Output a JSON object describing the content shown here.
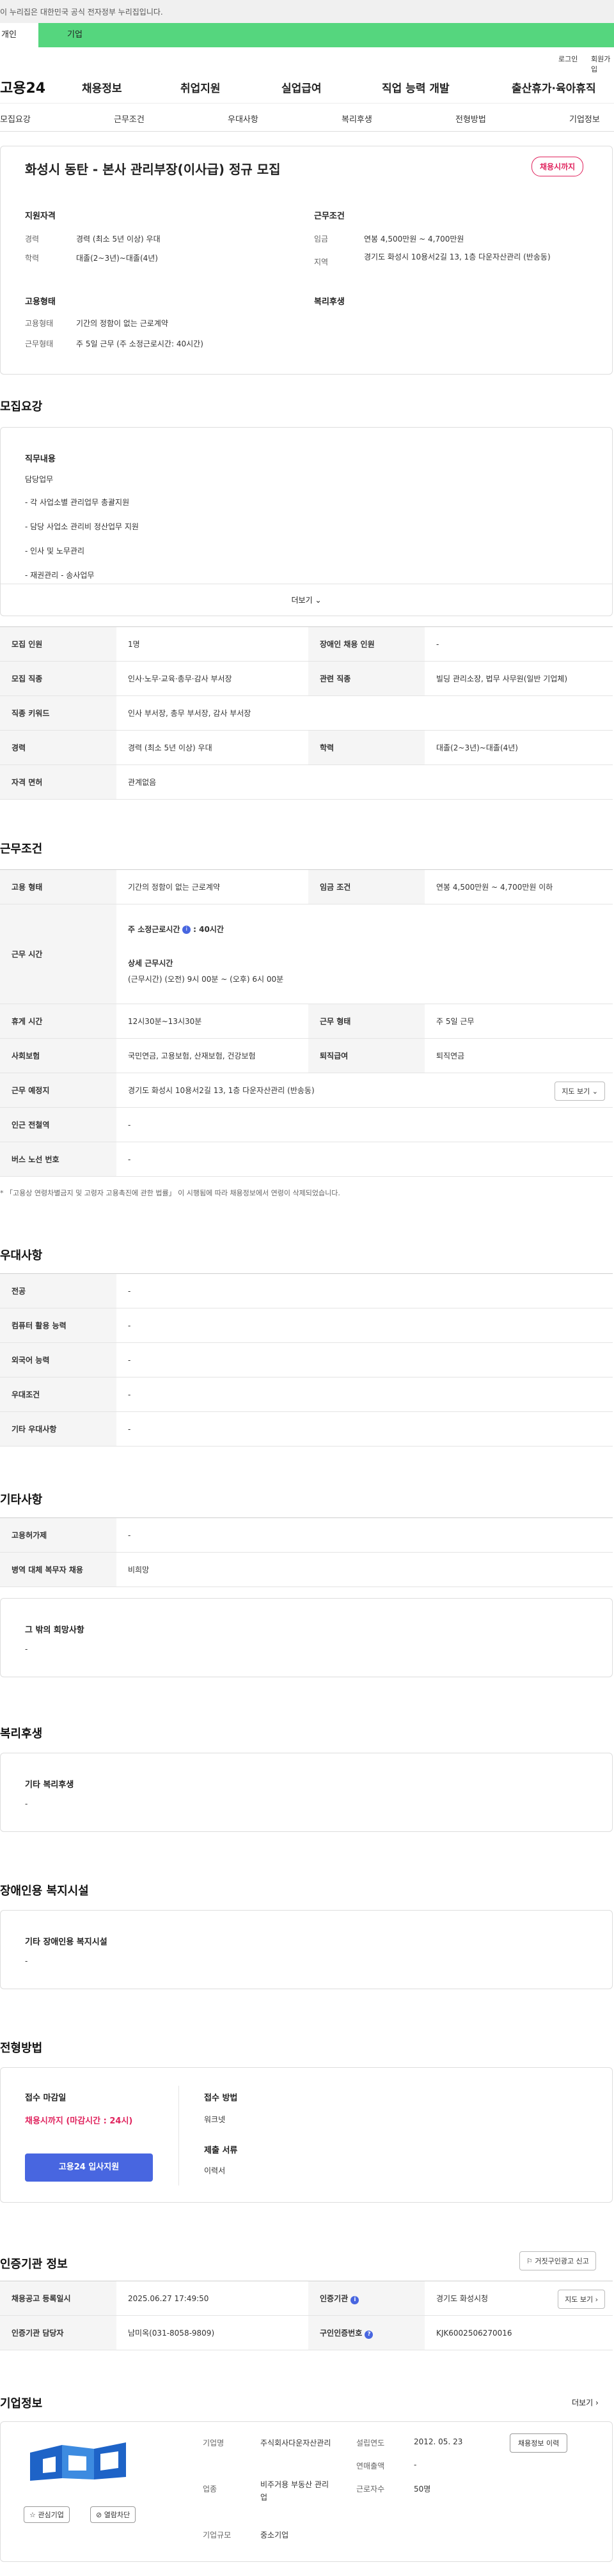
{
  "topbar": {
    "gov_notice": "이 누리집은 대한민국 공식 전자정부 누리집입니다."
  },
  "userbar": {
    "left": "개인",
    "right": "기업"
  },
  "util": {
    "login": "로그인",
    "join": "회원가입"
  },
  "gnb": {
    "logo": "고용24",
    "menus": [
      "채용정보",
      "취업지원",
      "실업급여",
      "직업 능력 개발",
      "출산휴가·육아휴직"
    ]
  },
  "tabs": [
    "모집요강",
    "근무조건",
    "우대사항",
    "복리후생",
    "전형방법",
    "기업정보"
  ],
  "summary": {
    "title": "화성시 동탄 - 본사 관리부장(이사급) 정규 모집",
    "badge": "채용시까지",
    "qual_heading": "지원자격",
    "career_label": "경력",
    "career_value": "경력 (최소 5년 이상) 우대",
    "edu_label": "학력",
    "edu_value": "대졸(2~3년)~대졸(4년)",
    "cond_heading": "근무조건",
    "wage_label": "임금",
    "wage_value": "연봉 4,500만원 ~ 4,700만원",
    "region_label": "지역",
    "region_value": "경기도 화성시 10용서2길 13, 1층 다운자산관리 (반송동)",
    "emp_heading": "고용형태",
    "emp_type_label": "고용형태",
    "emp_type_value": "기간의 정함이 없는 근로계약",
    "work_type_label": "근무형태",
    "work_type_value": "주 5일 근무 (주 소정근로시간: 40시간)",
    "welfare_heading": "복리후생"
  },
  "recruit": {
    "title": "모집요강",
    "job_heading": "직무내용",
    "lines": [
      "담당업무",
      "- 각 사업소별 관리업무 총괄지원",
      "- 담당 사업소 관리비 정산업무 지원",
      "- 인사 및 노무관리",
      "- 재권관리 - 송사업무"
    ],
    "more": "더보기",
    "rows": [
      [
        "모집 인원",
        "1명",
        "장애인 채용 인원",
        "-"
      ],
      [
        "모집 직종",
        "인사·노무·교육·총무·감사 부서장",
        "관련 직종",
        "빌딩 관리소장, 법무 사무원(일반 기업체)"
      ],
      [
        "직종 키워드",
        "인사 부서장, 총무 부서장, 감사 부서장",
        "",
        ""
      ],
      [
        "경력",
        "경력 (최소 5년 이상) 우대",
        "학력",
        "대졸(2~3년)~대졸(4년)"
      ],
      [
        "자격 면허",
        "관계없음",
        "",
        ""
      ]
    ]
  },
  "work": {
    "title": "근무조건",
    "emp_label": "고용 형태",
    "emp_value": "기간의 정함이 없는 근로계약",
    "wage_label": "임금 조건",
    "wage_value": "연봉 4,500만원 ~ 4,700만원 이하",
    "hours_label": "근무 시간",
    "hours_weekly": "주 소정근로시간",
    "hours_weekly_value": ": 40시간",
    "hours_detail_heading": "상세 근무시간",
    "hours_detail_value": "(근무시간) (오전) 9시 00분 ~ (오후) 6시 00분",
    "break_label": "휴게 시간",
    "break_value": "12시30분~13시30분",
    "form_label": "근무 형태",
    "form_value": "주 5일 근무",
    "insurance_label": "사회보험",
    "insurance_value": "국민연금, 고용보험, 산재보험, 건강보험",
    "retire_label": "퇴직급여",
    "retire_value": "퇴직연금",
    "place_label": "근무 예정지",
    "place_value": "경기도 화성시 10용서2길 13, 1층 다운자산관리 (반송동)",
    "map_btn": "지도 보기",
    "subway_label": "인근 전철역",
    "subway_value": "-",
    "bus_label": "버스 노선 번호",
    "bus_value": "-",
    "note": "* 「고용상 연령차별금지 및 고령자 고용촉진에 관한 법률」 이 시행됨에 따라 채용정보에서 연령이 삭제되었습니다."
  },
  "prefer": {
    "title": "우대사항",
    "rows": [
      [
        "전공",
        "-"
      ],
      [
        "컴퓨터 활용 능력",
        "-"
      ],
      [
        "외국어 능력",
        "-"
      ],
      [
        "우대조건",
        "-"
      ],
      [
        "기타 우대사항",
        "-"
      ]
    ]
  },
  "etc": {
    "title": "기타사항",
    "rows": [
      [
        "고용허가제",
        "-"
      ],
      [
        "병역 대체 복무자 채용",
        "비희망"
      ]
    ],
    "other_heading": "그 밖의 희망사항",
    "other_value": "-"
  },
  "welfare": {
    "title": "복리후생",
    "heading": "기타 복리후생",
    "value": "-"
  },
  "disabled": {
    "title": "장애인용 복지시설",
    "heading": "기타 장애인용 복지시설",
    "value": "-"
  },
  "process": {
    "title": "전형방법",
    "deadline_heading": "접수 마감일",
    "deadline_value": "채용시까지 (마감시간 : 24시)",
    "apply_btn": "고용24 입사지원",
    "method_heading": "접수 방법",
    "method_value": "워크넷",
    "docs_heading": "제출 서류",
    "docs_value": "이력서"
  },
  "cert": {
    "title": "인증기관 정보",
    "report_btn": "거짓구인광고 신고",
    "reg_label": "채용공고 등록일시",
    "reg_value": "2025.06.27 17:49:50",
    "org_label": "인증기관",
    "org_value": "경기도 화성시청",
    "map_btn": "지도 보기",
    "manager_label": "인증기관 담당자",
    "manager_value": "남미옥(031-8058-9809)",
    "num_label": "구인인증번호",
    "num_value": "KJK6002506270016"
  },
  "company": {
    "title": "기업정보",
    "more": "더보기",
    "name_label": "기업명",
    "name_value": "주식회사다운자산관리",
    "founded_label": "설립연도",
    "founded_value": "2012. 05. 23",
    "sales_label": "연매출액",
    "sales_value": "-",
    "industry_label": "업종",
    "industry_value": "비주거용 부동산 관리업",
    "employees_label": "근로자수",
    "employees_value": "50명",
    "scale_label": "기업규모",
    "scale_value": "중소기업",
    "other_jobs_btn": "채용정보 이력",
    "fav_btn": "관심기업",
    "block_btn": "열람차단"
  },
  "colors": {
    "accent_green": "#55d67e",
    "badge_red": "#e0245e",
    "apply_blue": "#4866e0"
  }
}
